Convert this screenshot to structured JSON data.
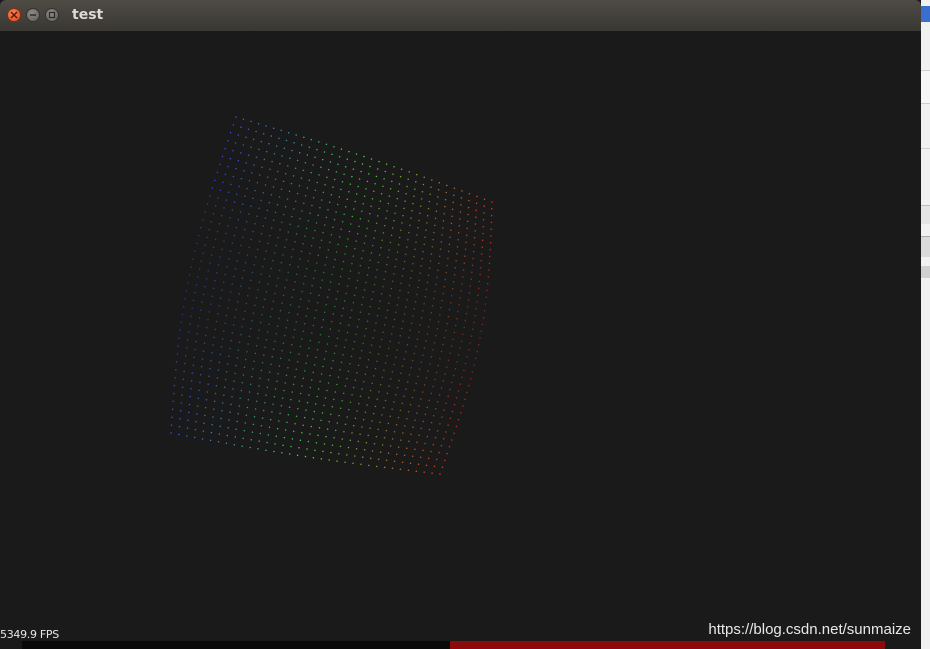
{
  "window": {
    "title": "test",
    "controls": [
      "close",
      "minimize",
      "maximize"
    ]
  },
  "viewport": {
    "fps_text": "5349.9 FPS",
    "background_color": "#1a1a1a",
    "point_cloud": {
      "colors": [
        "#3355ff",
        "#33dd33",
        "#ee3322"
      ],
      "description_icon": "point-cloud"
    }
  },
  "watermark": "https://blog.csdn.net/sunmaize",
  "colors": {
    "titlebar": "#3c3b37",
    "close_button": "#e95420",
    "bottom_red": "#8c0a0a"
  }
}
